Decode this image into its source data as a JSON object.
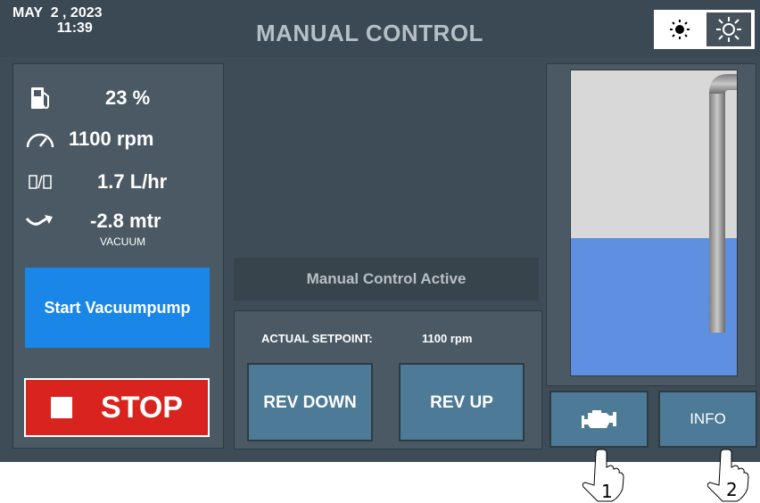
{
  "header": {
    "date": "MAY  2 , 2023",
    "time": "11:39",
    "title": "MANUAL CONTROL",
    "brightness_buttons": [
      "sun-dim-icon",
      "sun-bright-icon"
    ]
  },
  "stats": {
    "fuel": {
      "icon": "fuel-icon",
      "value": "23 %"
    },
    "speed": {
      "icon": "gauge-icon",
      "value": "1100 rpm"
    },
    "consumption": {
      "icon": "fuel-consumption-icon",
      "value": "1.7 L/hr"
    },
    "vacuum": {
      "icon": "flow-arrow-icon",
      "value": "-2.8 mtr",
      "sub": "VACUUM"
    }
  },
  "buttons": {
    "start": "Start Vacuumpump",
    "stop": "STOP",
    "rev_down": "REV DOWN",
    "rev_up": "REV UP",
    "engine": "engine-icon",
    "info": "INFO"
  },
  "status": {
    "message": "Manual Control Active"
  },
  "setpoint": {
    "label": "ACTUAL SETPOINT:",
    "value": "1100 rpm"
  },
  "tank": {
    "fill_percent": 45,
    "liquid_color": "#5f8fe0",
    "empty_color": "#d8d8d8"
  },
  "annotations": {
    "hand_1": "1",
    "hand_2": "2"
  },
  "colors": {
    "start_button": "#1a86e8",
    "stop_button": "#d9231f",
    "action_button": "#4d7a96",
    "background": "#3d4c56"
  }
}
